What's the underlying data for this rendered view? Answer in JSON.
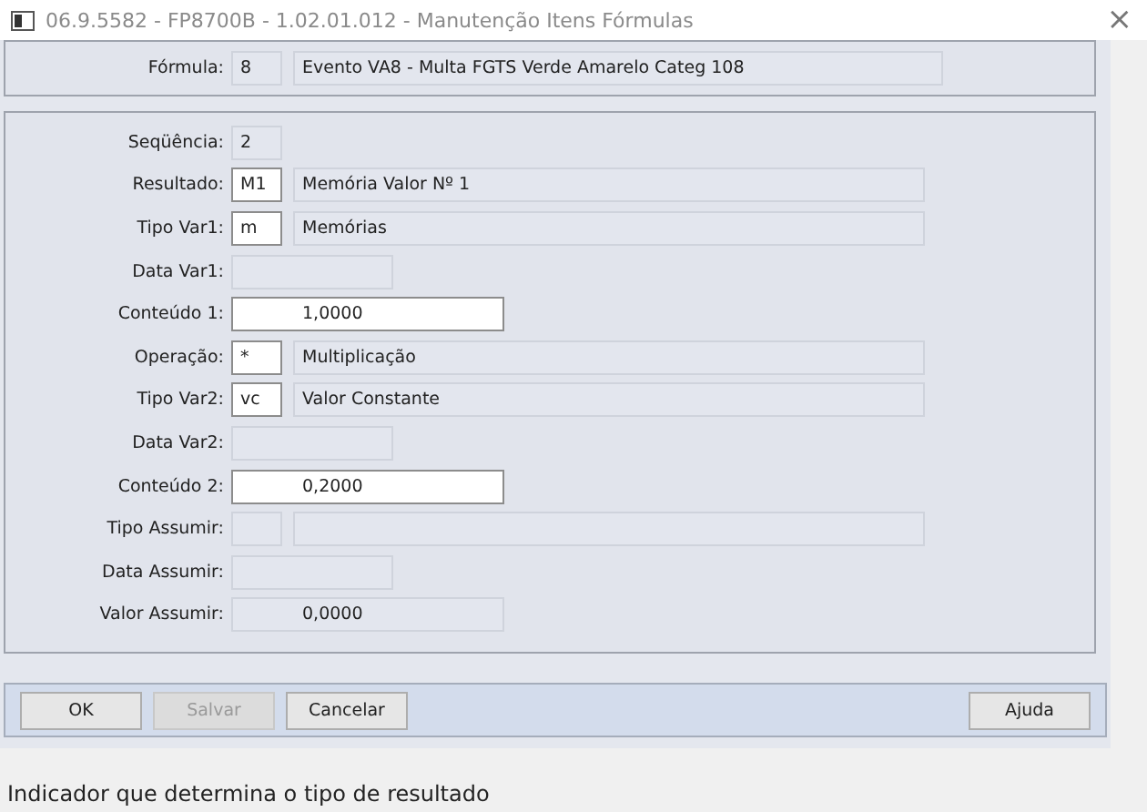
{
  "window": {
    "title": "06.9.5582 - FP8700B - 1.02.01.012 - Manutenção Itens Fórmulas",
    "close": "×"
  },
  "header": {
    "label": "Fórmula:",
    "fields": [
      {
        "kind": "short",
        "value": "8",
        "editable": false
      },
      {
        "kind": "wide",
        "value": "Evento VA8 - Multa FGTS Verde Amarelo Categ 108",
        "editable": false
      }
    ]
  },
  "rows": [
    {
      "label": "Seqüência:",
      "fields": [
        {
          "kind": "code",
          "value": "2",
          "editable": false
        }
      ]
    },
    {
      "label": "Resultado:",
      "fields": [
        {
          "kind": "code",
          "value": "M1",
          "editable": true
        },
        {
          "kind": "desc",
          "value": "Memória Valor Nº 1",
          "editable": false
        }
      ]
    },
    {
      "label": "Tipo Var1:",
      "fields": [
        {
          "kind": "code",
          "value": "m",
          "editable": true
        },
        {
          "kind": "desc",
          "value": "Memórias",
          "editable": false
        }
      ]
    },
    {
      "label": "Data Var1:",
      "fields": [
        {
          "kind": "date",
          "editable": false
        }
      ]
    },
    {
      "label": "Conteúdo 1:",
      "fields": [
        {
          "kind": "number",
          "value": "1,0000",
          "editable": true
        }
      ]
    },
    {
      "label": "Operação:",
      "fields": [
        {
          "kind": "code",
          "value": "*",
          "editable": true
        },
        {
          "kind": "desc",
          "value": "Multiplicação",
          "editable": false
        }
      ]
    },
    {
      "label": "Tipo Var2:",
      "fields": [
        {
          "kind": "code",
          "value": "vc",
          "editable": true
        },
        {
          "kind": "desc",
          "value": "Valor Constante",
          "editable": false
        }
      ]
    },
    {
      "label": "Data Var2:",
      "fields": [
        {
          "kind": "date",
          "editable": false
        }
      ]
    },
    {
      "label": "Conteúdo 2:",
      "fields": [
        {
          "kind": "number",
          "value": "0,2000",
          "editable": true
        }
      ]
    },
    {
      "label": "Tipo Assumir:",
      "fields": [
        {
          "kind": "code",
          "editable": false
        },
        {
          "kind": "desc",
          "editable": false
        }
      ]
    },
    {
      "label": "Data Assumir:",
      "fields": [
        {
          "kind": "date",
          "editable": false
        }
      ]
    },
    {
      "label": "Valor Assumir:",
      "fields": [
        {
          "kind": "number",
          "value": "0,0000",
          "editable": false
        }
      ]
    }
  ],
  "buttons": [
    {
      "label": "OK",
      "disabled": false
    },
    {
      "label": "Salvar",
      "disabled": true
    },
    {
      "label": "Cancelar",
      "disabled": false
    }
  ],
  "help_button": {
    "label": "Ajuda"
  },
  "status_bar": "Indicador que determina o tipo de resultado"
}
